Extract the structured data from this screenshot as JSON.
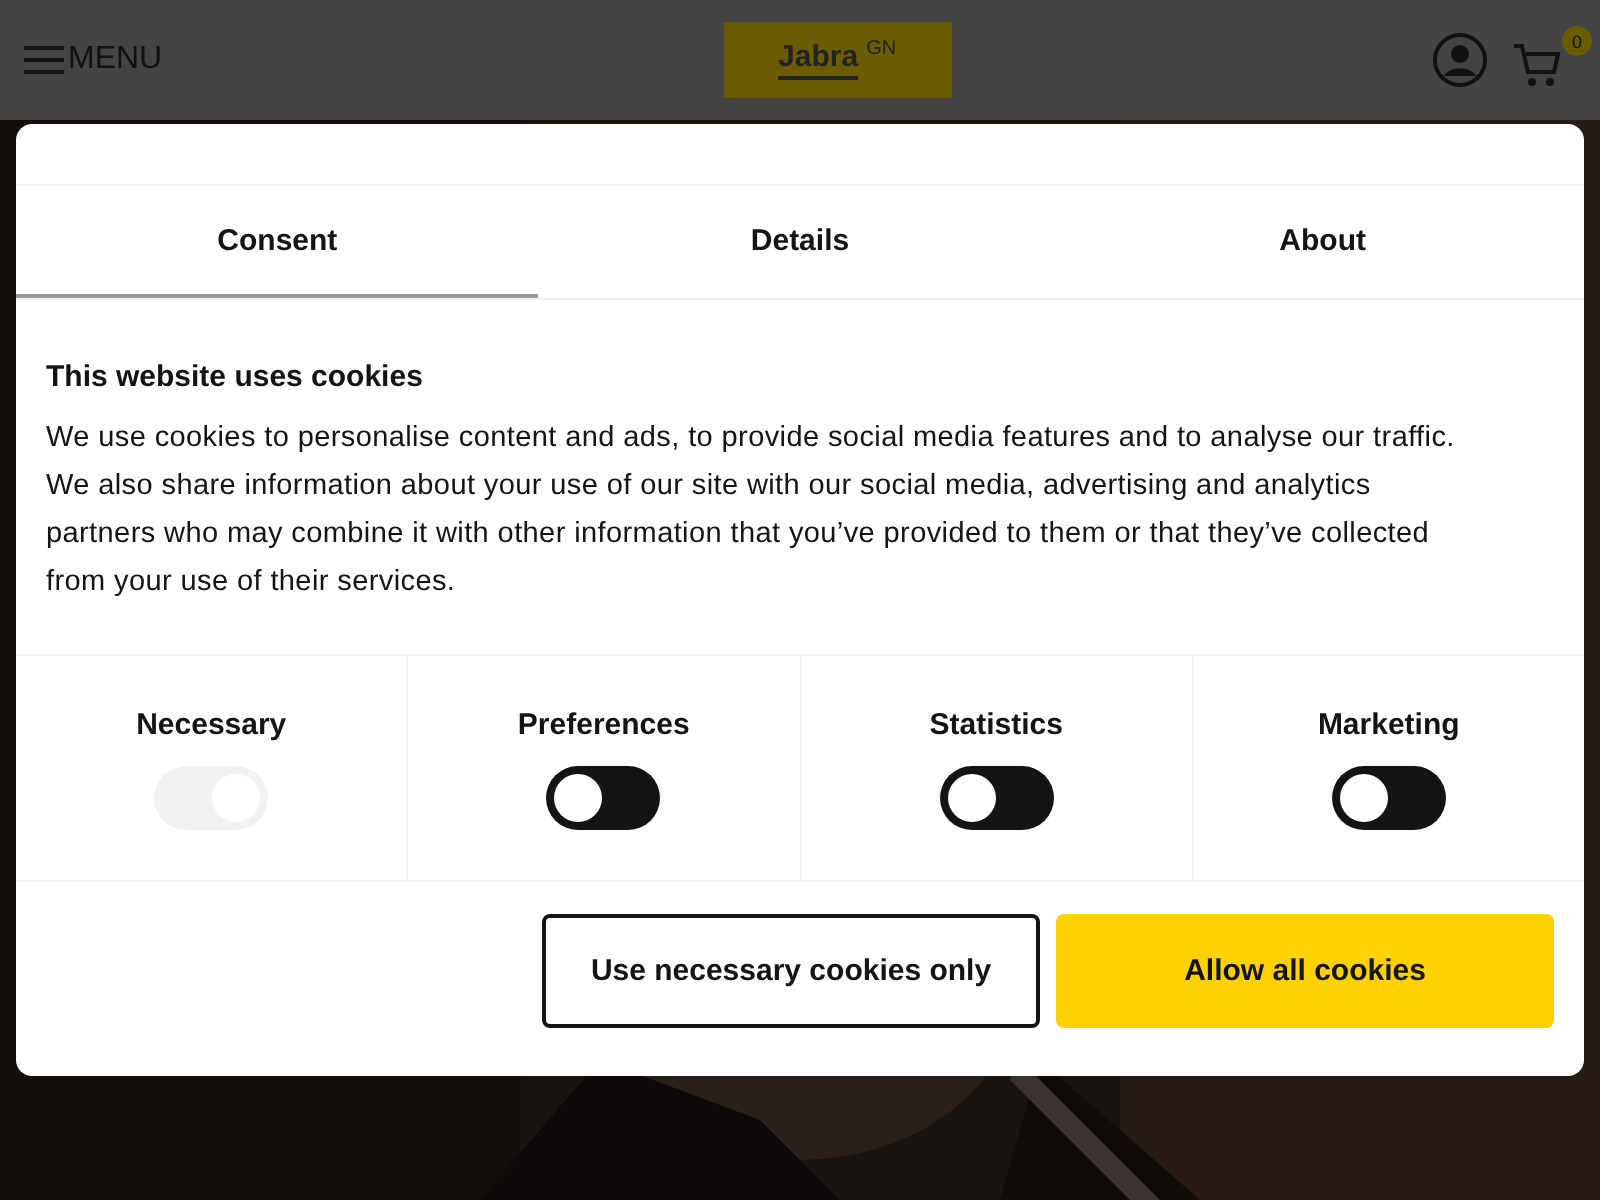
{
  "header": {
    "menu_label": "MENU",
    "logo_text": "Jabra",
    "logo_mark": "GN",
    "cart_count": "0"
  },
  "tabs": [
    {
      "label": "Consent",
      "selected": true
    },
    {
      "label": "Details",
      "selected": false
    },
    {
      "label": "About",
      "selected": false
    }
  ],
  "heading": "This website uses cookies",
  "body": "We use cookies to personalise content and ads, to provide social media features and to analyse our traffic. We also share information about your use of our site with our social media, advertising and analytics partners who may combine it with other information that you’ve provided to them or that they’ve collected from your use of their services.",
  "toggles": [
    {
      "label": "Necessary",
      "on": true,
      "disabled": true
    },
    {
      "label": "Preferences",
      "on": false,
      "disabled": false
    },
    {
      "label": "Statistics",
      "on": false,
      "disabled": false
    },
    {
      "label": "Marketing",
      "on": false,
      "disabled": false
    }
  ],
  "buttons": [
    {
      "label": "Use necessary cookies only",
      "kind": "outline"
    },
    {
      "label": "Allow all cookies",
      "kind": "primary"
    }
  ]
}
